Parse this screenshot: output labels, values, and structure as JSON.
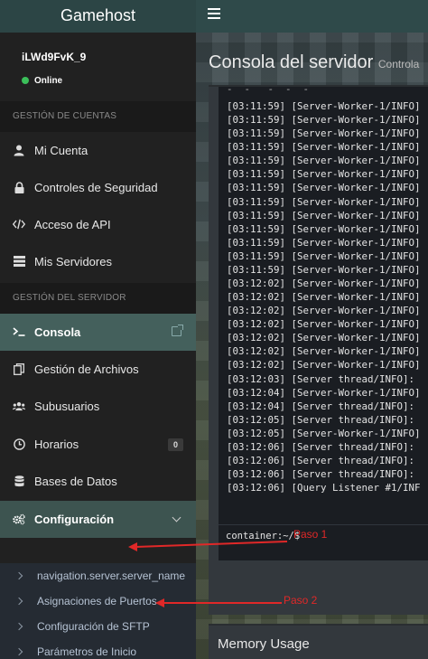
{
  "header": {
    "brand": "Gamehost",
    "menu_icon": "hamburger-icon"
  },
  "user": {
    "name": "iLWd9FvK_9",
    "status": "Online",
    "status_color": "#3bbf5a"
  },
  "sidebar": {
    "section_account": "GESTIÓN DE CUENTAS",
    "account_items": [
      {
        "label": "Mi Cuenta",
        "icon": "user-icon"
      },
      {
        "label": "Controles de Seguridad",
        "icon": "lock-icon"
      },
      {
        "label": "Acceso de API",
        "icon": "code-icon"
      },
      {
        "label": "Mis Servidores",
        "icon": "server-list-icon"
      }
    ],
    "section_server": "GESTIÓN DEL SERVIDOR",
    "server_items": [
      {
        "label": "Consola",
        "icon": "terminal-icon",
        "active": true
      },
      {
        "label": "Gestión de Archivos",
        "icon": "files-icon"
      },
      {
        "label": "Subusuarios",
        "icon": "users-icon"
      },
      {
        "label": "Horarios",
        "icon": "clock-icon",
        "badge": "0"
      },
      {
        "label": "Bases de Datos",
        "icon": "database-icon"
      },
      {
        "label": "Configuración",
        "icon": "gears-icon"
      }
    ],
    "config_subitems": [
      "navigation.server.server_name",
      "Asignaciones de Puertos",
      "Configuración de SFTP",
      "Parámetros de Inicio"
    ]
  },
  "main": {
    "title": "Consola del servidor",
    "subtitle": "Controla",
    "console_lines": [
      "[03:11:59] [Server-Worker-1/INFO]",
      "[03:11:59] [Server-Worker-1/INFO]",
      "[03:11:59] [Server-Worker-1/INFO]",
      "[03:11:59] [Server-Worker-1/INFO]",
      "[03:11:59] [Server-Worker-1/INFO]",
      "[03:11:59] [Server-Worker-1/INFO]",
      "[03:11:59] [Server-Worker-1/INFO]",
      "[03:11:59] [Server-Worker-1/INFO]",
      "[03:11:59] [Server-Worker-1/INFO]",
      "[03:11:59] [Server-Worker-1/INFO]",
      "[03:11:59] [Server-Worker-1/INFO]",
      "[03:11:59] [Server-Worker-1/INFO]",
      "[03:11:59] [Server-Worker-1/INFO]",
      "[03:12:02] [Server-Worker-1/INFO]",
      "[03:12:02] [Server-Worker-1/INFO]",
      "[03:12:02] [Server-Worker-1/INFO]",
      "[03:12:02] [Server-Worker-1/INFO]",
      "[03:12:02] [Server-Worker-1/INFO]",
      "[03:12:02] [Server-Worker-1/INFO]",
      "[03:12:02] [Server-Worker-1/INFO]",
      "[03:12:03] [Server thread/INFO]:",
      "[03:12:04] [Server-Worker-1/INFO]",
      "[03:12:04] [Server thread/INFO]:",
      "[03:12:05] [Server thread/INFO]:",
      "[03:12:05] [Server-Worker-1/INFO]",
      "[03:12:06] [Server thread/INFO]:",
      "[03:12:06] [Server thread/INFO]:",
      "[03:12:06] [Server thread/INFO]:",
      "[03:12:06] [Query Listener #1/INF"
    ],
    "prompt": "container:~/$",
    "memory_title": "Memory Usage"
  },
  "annotations": {
    "step1": "Paso 1",
    "step2": "Paso 2",
    "color": "#e02828"
  }
}
